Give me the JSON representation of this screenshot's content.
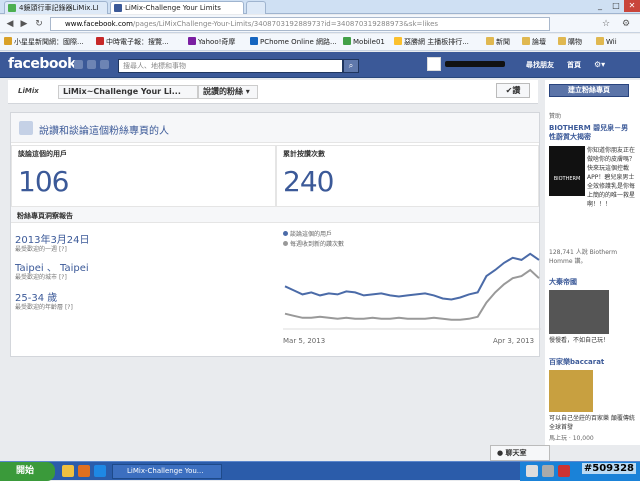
{
  "browser": {
    "tabs": [
      {
        "label": "4鏡頭行車記錄器LiMix.LI",
        "active": false
      },
      {
        "label": "LiMix-Challenge Your Limits",
        "active": true
      }
    ],
    "url_host": "www.facebook.com",
    "url_rest": "/pages/LiMixChallenge-Your-Limits/340870319288973?id=340870319288973&sk=likes",
    "bookmarks": [
      "小星星新聞網：國際...",
      "中時電子報：搜覽...",
      "Yahoo!奇摩",
      "PChome Online 網路...",
      "Mobile01",
      "惡勝網 主播板排行...",
      "新聞",
      "論壇",
      "購物",
      "Wii"
    ]
  },
  "fb": {
    "logo": "facebook",
    "search_placeholder": "搜尋人、地標和事物",
    "find_friends": "尋找朋友",
    "home": "首頁"
  },
  "page": {
    "logo": "LiMix",
    "name": "LiMix~Challenge Your Li...",
    "dropdown": "說讚的粉絲",
    "like_button": "✔讚"
  },
  "main": {
    "title": "說讚和談論這個粉絲專頁的人",
    "talking_label": "談論這個的用戶",
    "talking_value": "106",
    "reach_label": "累計按讚次數",
    "reach_value": "240",
    "insights_title": "粉絲專頁洞察報告",
    "stats": [
      {
        "value": "2013年3月24日",
        "label": "最受歡迎的一週",
        "help": "[?]"
      },
      {
        "value": "Taipei 、 Taipei",
        "label": "最受歡迎的城市",
        "help": "[?]"
      },
      {
        "value": "25-34 歲",
        "label": "最受歡迎的年齡層",
        "help": "[?]"
      }
    ]
  },
  "chart_data": {
    "type": "line",
    "x_start": "Mar 5, 2013",
    "x_end": "Apr 3, 2013",
    "series": [
      {
        "name": "談論這個的用戶",
        "color": "#4b6ba8",
        "values": [
          42,
          38,
          34,
          36,
          33,
          35,
          34,
          37,
          36,
          33,
          34,
          35,
          33,
          32,
          33,
          34,
          35,
          33,
          30,
          29,
          31,
          34,
          36,
          52,
          58,
          65,
          70,
          68,
          74,
          68
        ]
      },
      {
        "name": "每週收到新的讚次數",
        "color": "#999999",
        "values": [
          15,
          13,
          11,
          11,
          12,
          11,
          10,
          11,
          10,
          10,
          11,
          10,
          10,
          11,
          10,
          10,
          10,
          11,
          10,
          9,
          9,
          10,
          12,
          26,
          36,
          44,
          50,
          52,
          58,
          50
        ]
      }
    ]
  },
  "ads": {
    "create_button": "建立粉絲專頁",
    "sponsored": "贊助",
    "ad1_title": "BIOTHERM 碧兒泉－男性蔚質大揭密",
    "ad1_text": "你知道你朋友正在做啥你的皮膚嗎？快來玩這個控載APP！碧兒泉男士全效修護乳是你每上簡的的唯一救星啊！！！",
    "ad1_likes": "128,741 人說 Biotherm Homme 讚。",
    "ad2_title": "大秦帝國",
    "ad2_text": "慢慢看，不如自己玩！",
    "ad3_title": "百家樂baccarat",
    "ad3_text": "可以自己坐莊的百家樂 顛覆傳統 全球首發",
    "ad3_likes": "馬上玩 · 10,000"
  },
  "chat": {
    "label": "聊天室"
  },
  "taskbar": {
    "start": "開始",
    "task": "LiMix-Challenge You...",
    "watermark": "#509328"
  }
}
